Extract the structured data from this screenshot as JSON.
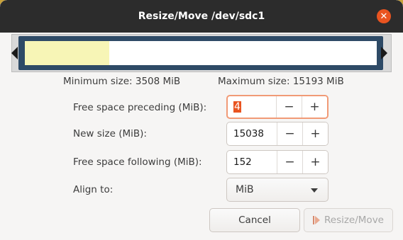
{
  "window": {
    "title": "Resize/Move /dev/sdc1",
    "close_symbol": "✕"
  },
  "partition": {
    "used_fraction": 0.24,
    "used_color": "#f7f5b6",
    "frame_color": "#2e4a66"
  },
  "limits": {
    "min_label": "Minimum size: 3508 MiB",
    "max_label": "Maximum size: 15193 MiB"
  },
  "fields": {
    "free_preceding": {
      "label": "Free space preceding (MiB):",
      "value": "4"
    },
    "new_size": {
      "label": "New size (MiB):",
      "value": "15038"
    },
    "free_following": {
      "label": "Free space following (MiB):",
      "value": "152"
    },
    "align": {
      "label": "Align to:",
      "value": "MiB"
    }
  },
  "spin_buttons": {
    "minus": "−",
    "plus": "+"
  },
  "buttons": {
    "cancel": "Cancel",
    "resize_move": "Resize/Move"
  },
  "colors": {
    "accent": "#e95420",
    "titlebar": "#2c2c2c"
  }
}
